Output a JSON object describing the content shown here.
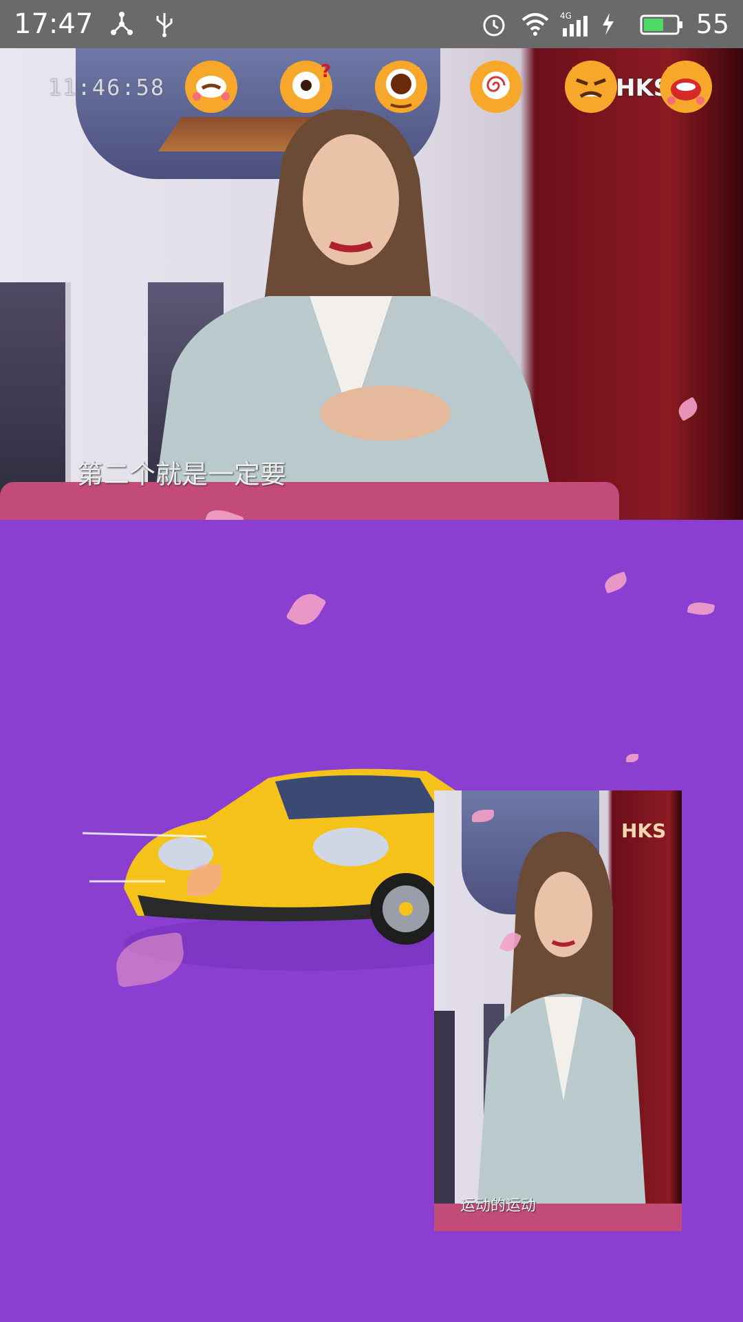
{
  "status_bar": {
    "time": "17:47",
    "battery": "55",
    "network": "4G",
    "icons": [
      "network-share-icon",
      "usb-icon",
      "alarm-icon",
      "wifi-icon",
      "signal-icon",
      "charging-icon",
      "battery-icon"
    ]
  },
  "main_video": {
    "timecode": "11:46:58",
    "subtitle": "第二个就是一定要",
    "watermark": "HKS",
    "emoji_reactions": [
      "sleepy-face-emoji",
      "confused-face-emoji",
      "shocked-face-emoji",
      "dizzy-face-emoji",
      "angry-face-emoji",
      "shouting-face-emoji"
    ]
  },
  "gift_animation": {
    "item": "yellow-sports-car",
    "colors": {
      "background": "#8a3fd1",
      "car": "#f5c21a",
      "petal": "#f2a1c6"
    }
  },
  "pip_video": {
    "logo": "HKS",
    "subtitle": "运动的运动"
  }
}
